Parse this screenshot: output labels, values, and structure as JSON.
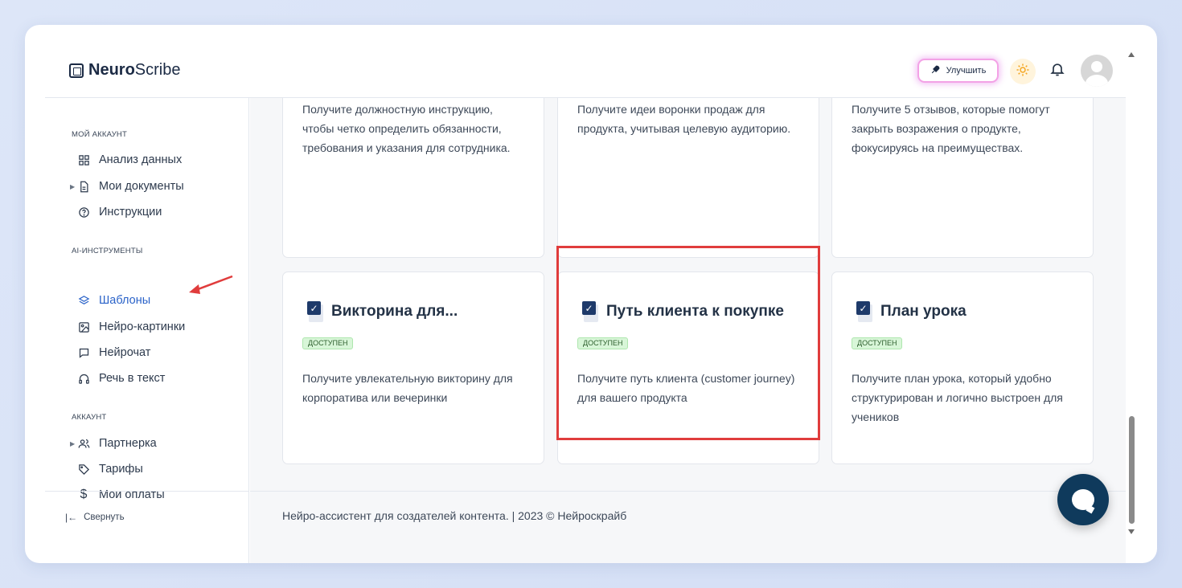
{
  "app": {
    "logo_bold": "Neuro",
    "logo_light": "Scribe"
  },
  "header": {
    "upgrade_label": "Улучшить"
  },
  "sidebar": {
    "sections": [
      {
        "title": "МОЙ АККАУНТ",
        "items": [
          {
            "label": "Анализ данных",
            "icon": "grid-icon"
          },
          {
            "label": "Мои документы",
            "icon": "document-icon"
          },
          {
            "label": "Инструкции",
            "icon": "help-circle-icon"
          }
        ]
      },
      {
        "title": "AI-ИНСТРУМЕНТЫ",
        "items": [
          {
            "label": "Шаблоны",
            "icon": "layers-icon"
          },
          {
            "label": "Нейро-картинки",
            "icon": "image-icon"
          },
          {
            "label": "Нейрочат",
            "icon": "chat-icon"
          },
          {
            "label": "Речь в текст",
            "icon": "headphones-icon"
          }
        ]
      },
      {
        "title": "АККАУНТ",
        "items": [
          {
            "label": "Партнерка",
            "icon": "users-icon"
          },
          {
            "label": "Тарифы",
            "icon": "tag-icon"
          },
          {
            "label": "Мои оплаты",
            "icon": "dollar-icon"
          }
        ]
      }
    ],
    "collapse_label": "Свернуть"
  },
  "cards_top": [
    {
      "desc": "Получите должностную инструкцию, чтобы четко определить обязанности, требования и указания для сотрудника."
    },
    {
      "desc": "Получите идеи воронки продаж для продукта, учитывая целевую аудиторию."
    },
    {
      "desc": "Получите 5 отзывов, которые помогут закрыть возражения о продукте, фокусируясь на преимуществах."
    }
  ],
  "cards_bottom": [
    {
      "title": "Викторина для...",
      "badge": "ДОСТУПЕН",
      "desc": "Получите увлекательную викторину для корпоратива или вечеринки"
    },
    {
      "title": "Путь клиента к покупке",
      "badge": "ДОСТУПЕН",
      "desc": "Получите путь клиента (customer journey) для вашего продукта"
    },
    {
      "title": "План урока",
      "badge": "ДОСТУПЕН",
      "desc": "Получите план урока, который удобно структурирован и логично выстроен для учеников"
    }
  ],
  "footer": {
    "text": "Нейро-ассистент для создателей контента.  | 2023 © Нейроскрайб"
  },
  "colors": {
    "accent": "#2b63c9",
    "highlight": "#e03c3c",
    "badge_bg": "#d8f6d8",
    "chat_button": "#0f3a5c"
  }
}
